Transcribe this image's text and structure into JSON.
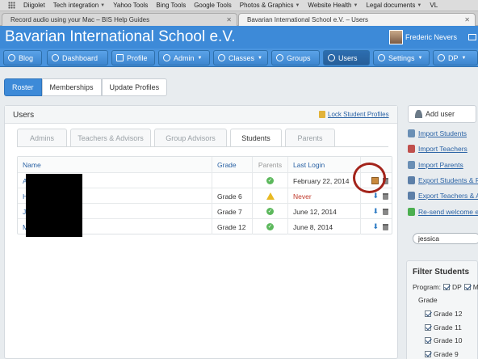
{
  "bookmarks": [
    {
      "label": "Diigolet",
      "menu": false
    },
    {
      "label": "Tech integration",
      "menu": true
    },
    {
      "label": "Yahoo Tools",
      "menu": false
    },
    {
      "label": "Bing Tools",
      "menu": false
    },
    {
      "label": "Google Tools",
      "menu": false
    },
    {
      "label": "Photos & Graphics",
      "menu": true
    },
    {
      "label": "Website Health",
      "menu": true
    },
    {
      "label": "Legal documents",
      "menu": true
    },
    {
      "label": "VL",
      "menu": false
    }
  ],
  "tabs": [
    {
      "label": "Record audio using your Mac – BIS Help Guides",
      "active": false
    },
    {
      "label": "Bavarian International School e.V. – Users",
      "active": true
    }
  ],
  "header": {
    "site_title": "Bavarian International School e.V.",
    "user_name": "Frederic Nevers"
  },
  "nav": [
    {
      "label": "Blog",
      "icon": "rss-icon",
      "dropdown": false,
      "active": false
    },
    {
      "label": "Dashboard",
      "icon": "dashboard-icon",
      "dropdown": false,
      "active": false
    },
    {
      "label": "Profile",
      "icon": "profile-card-icon",
      "dropdown": false,
      "active": false
    },
    {
      "label": "Admin",
      "icon": "globe-icon",
      "dropdown": true,
      "active": false
    },
    {
      "label": "Classes",
      "icon": "classes-icon",
      "dropdown": true,
      "active": false
    },
    {
      "label": "Groups",
      "icon": "groups-icon",
      "dropdown": false,
      "active": false
    },
    {
      "label": "Users",
      "icon": "user-icon",
      "dropdown": false,
      "active": true
    },
    {
      "label": "Settings",
      "icon": "gear-icon",
      "dropdown": true,
      "active": false
    },
    {
      "label": "DP",
      "icon": "search-icon",
      "dropdown": true,
      "active": false
    }
  ],
  "subtabs": [
    "Roster",
    "Memberships",
    "Update Profiles"
  ],
  "panel": {
    "title": "Users",
    "lock_link": "Lock Student Profiles"
  },
  "role_tabs": [
    "Admins",
    "Teachers & Advisors",
    "Group Advisors",
    "Students",
    "Parents"
  ],
  "active_role_tab": "Students",
  "table": {
    "headers": {
      "name": "Name",
      "grade": "Grade",
      "parents": "Parents",
      "login": "Last Login"
    },
    "rows": [
      {
        "name": "A",
        "grade": "",
        "parents": "ok",
        "login": "February 22, 2014",
        "login_never": false,
        "actions": "package-delete"
      },
      {
        "name": "H",
        "grade": "Grade 6",
        "parents": "warning",
        "login": "Never",
        "login_never": true,
        "actions": "arrow-delete"
      },
      {
        "name": "J",
        "grade": "Grade 7",
        "parents": "ok",
        "login": "June 12, 2014",
        "login_never": false,
        "actions": "arrow-delete"
      },
      {
        "name": "M                              essica (Jessie)",
        "grade": "Grade 12",
        "parents": "ok",
        "login": "June 8, 2014",
        "login_never": false,
        "actions": "arrow-delete"
      }
    ]
  },
  "sidebar": {
    "add_user": "Add user",
    "links": [
      {
        "label": "Import Students",
        "icon": "import-students-icon",
        "color": "#6a8fb5"
      },
      {
        "label": "Import Teachers",
        "icon": "import-teachers-icon",
        "color": "#c0504d"
      },
      {
        "label": "Import Parents",
        "icon": "import-parents-icon",
        "color": "#6a8fb5"
      },
      {
        "label": "Export Students & P",
        "icon": "export-students-icon",
        "color": "#5c7fa8"
      },
      {
        "label": "Export Teachers & A",
        "icon": "export-teachers-icon",
        "color": "#5c7fa8"
      },
      {
        "label": "Re-send welcome e",
        "icon": "email-icon",
        "color": "#4caf50"
      }
    ],
    "search_value": "jessica",
    "filter": {
      "title": "Filter Students",
      "program_label": "Program:",
      "programs": [
        "DP",
        "M"
      ],
      "grade_label": "Grade",
      "grades": [
        "Grade 12",
        "Grade 11",
        "Grade 10",
        "Grade 9"
      ]
    }
  },
  "colors": {
    "header_blue": "#3d8ad8",
    "link_blue": "#2b63a5",
    "highlight_red": "#a3241b",
    "never_red": "#c0392b"
  }
}
